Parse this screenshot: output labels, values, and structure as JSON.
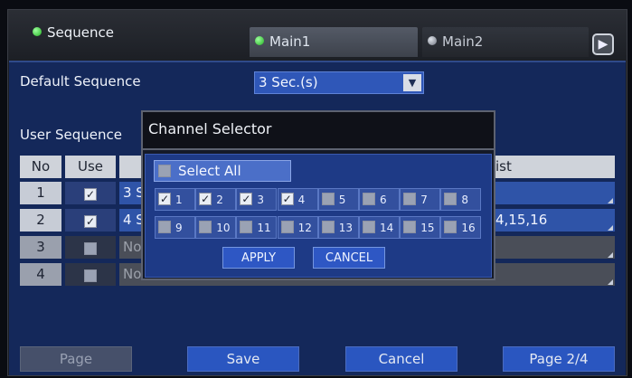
{
  "header": {
    "title": "Sequence",
    "tabs": [
      {
        "label": "Main1",
        "active": true
      },
      {
        "label": "Main2",
        "active": false
      }
    ],
    "next_icon": "chevron-right-icon"
  },
  "default_sequence": {
    "label": "Default Sequence",
    "value": "3 Sec.(s)"
  },
  "user_sequence": {
    "label": "User Sequence",
    "columns": {
      "no": "No",
      "use": "Use",
      "list": "List"
    },
    "list_header_visible": "ist",
    "rows": [
      {
        "no": "1",
        "use": true,
        "dwell_visible": "3 S",
        "list_visible": ""
      },
      {
        "no": "2",
        "use": true,
        "dwell_visible": "4 S",
        "list_visible": "4,15,16"
      },
      {
        "no": "3",
        "use": false,
        "dwell_visible": "No",
        "list_visible": ""
      },
      {
        "no": "4",
        "use": false,
        "dwell_visible": "No",
        "list_visible": ""
      }
    ]
  },
  "channel_selector": {
    "title": "Channel Selector",
    "select_all_label": "Select All",
    "select_all_checked": false,
    "channels": [
      {
        "label": "1",
        "checked": true
      },
      {
        "label": "2",
        "checked": true
      },
      {
        "label": "3",
        "checked": true
      },
      {
        "label": "4",
        "checked": true
      },
      {
        "label": "5",
        "checked": false
      },
      {
        "label": "6",
        "checked": false
      },
      {
        "label": "7",
        "checked": false
      },
      {
        "label": "8",
        "checked": false
      },
      {
        "label": "9",
        "checked": false
      },
      {
        "label": "10",
        "checked": false
      },
      {
        "label": "11",
        "checked": false
      },
      {
        "label": "12",
        "checked": false
      },
      {
        "label": "13",
        "checked": false
      },
      {
        "label": "14",
        "checked": false
      },
      {
        "label": "15",
        "checked": false
      },
      {
        "label": "16",
        "checked": false
      }
    ],
    "apply_label": "APPLY",
    "cancel_label": "CANCEL"
  },
  "footer": {
    "page_label": "Page",
    "save_label": "Save",
    "cancel_label": "Cancel",
    "page_indicator": "Page 2/4"
  },
  "colors": {
    "panel_bg": "#14285a",
    "accent": "#2a56c0",
    "active_dot": "#22b022"
  }
}
